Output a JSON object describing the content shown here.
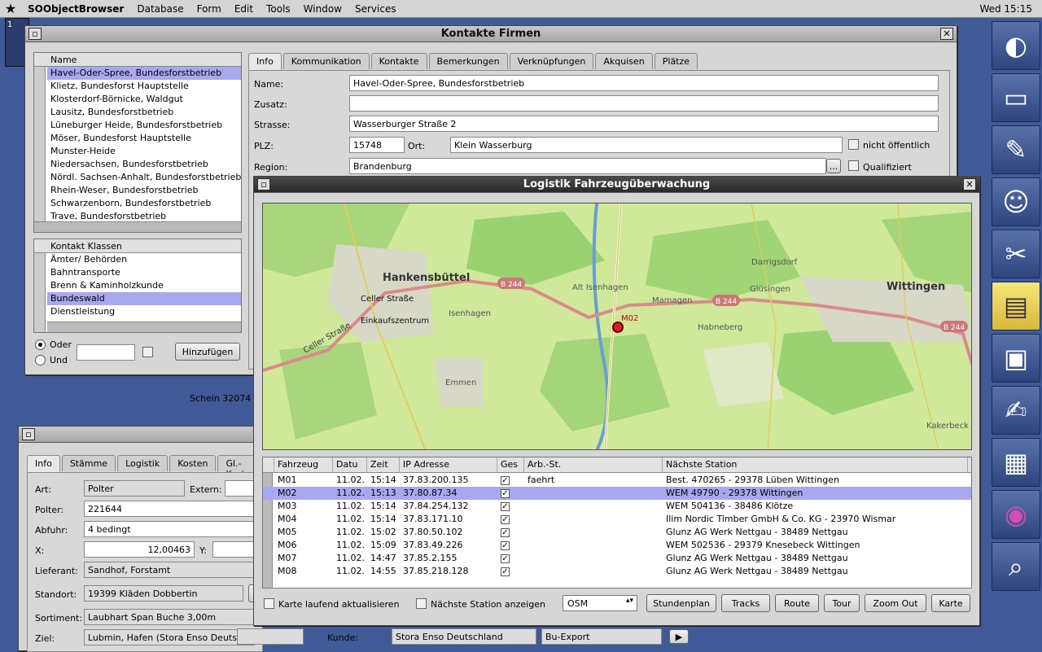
{
  "menubar": {
    "app": "SOObjectBrowser",
    "items": [
      "Database",
      "Form",
      "Edit",
      "Tools",
      "Window",
      "Services"
    ],
    "clock": "Wed 15:15"
  },
  "desktop": {
    "workspace_number": "1",
    "background_text": "Schein 32074"
  },
  "dock": [
    "system-icon",
    "monitor-icon",
    "paint-icon",
    "finder-icon",
    "tools-icon",
    "notes-icon",
    "terminal-icon",
    "textedit-icon",
    "graph-icon",
    "disk-icon",
    "magnifier-icon"
  ],
  "firmen": {
    "title": "Kontakte Firmen",
    "name_header": "Name",
    "names": [
      "Havel-Oder-Spree, Bundesforstbetrieb",
      "Klietz, Bundesforst Hauptstelle",
      "Klosterdorf-Börnicke, Waldgut",
      "Lausitz, Bundesforstbetrieb",
      "Lüneburger Heide, Bundesforstbetrieb",
      "Möser, Bundesforst Hauptstelle",
      "Munster-Heide",
      "Niedersachsen, Bundesforstbetrieb",
      "Nördl. Sachsen-Anhalt, Bundesforstbetrieb",
      "Rhein-Weser, Bundesforstbetrieb",
      "Schwarzenborn, Bundesforstbetrieb",
      "Trave, Bundesforstbetrieb"
    ],
    "klassen_header": "Kontakt Klassen",
    "klassen": [
      "Ämter/ Behörden",
      "Bahntransporte",
      "Brenn & Kaminholzkunde",
      "Bundeswald",
      "Dienstleistung"
    ],
    "oder": "Oder",
    "und": "Und",
    "add_button": "Hinzufügen",
    "tabs": [
      "Info",
      "Kommunikation",
      "Kontakte",
      "Bemerkungen",
      "Verknüpfungen",
      "Akquisen",
      "Plätze"
    ],
    "labels": {
      "name": "Name:",
      "zusatz": "Zusatz:",
      "strasse": "Strasse:",
      "plz": "PLZ:",
      "ort": "Ort:",
      "region": "Region:",
      "nicht_oeffentlich": "nicht öffentlich",
      "qualifiziert": "Qualifiziert"
    },
    "values": {
      "name": "Havel-Oder-Spree, Bundesforstbetrieb",
      "zusatz": "",
      "strasse": "Wasserburger Straße 2",
      "plz": "15748",
      "ort": "Klein Wasserburg",
      "region": "Brandenburg"
    },
    "region_button": "..."
  },
  "polter": {
    "tabs": [
      "Info",
      "Stämme",
      "Logistik",
      "Kosten",
      "Gl.-Kosten"
    ],
    "labels": {
      "art": "Art:",
      "extern": "Extern:",
      "polter": "Polter:",
      "abfuhr": "Abfuhr:",
      "x": "X:",
      "y": "Y:",
      "lieferant": "Lieferant:",
      "standort": "Standort:",
      "sortiment": "Sortiment:",
      "ziel": "Ziel:",
      "kunde": "Kunde:"
    },
    "values": {
      "art": "Polter",
      "polter": "221644",
      "abfuhr": "4 bedingt",
      "x": "12,00463",
      "lieferant": "Sandhof, Forstamt",
      "standort": "19399 Kläden Dobbertin",
      "sortiment": "Laubhart Span Buche 3,00m",
      "ziel": "Lubmin, Hafen (Stora Enso Deutschland GmbH)",
      "kunde": "Stora Enso Deutschland",
      "export": "Bu-Export"
    }
  },
  "logistik": {
    "title": "Logistik Fahrzeugüberwachung",
    "map_labels": [
      "Hankensbüttel",
      "Celler Straße",
      "Einkaufszentrum",
      "Isenhagen",
      "Alt Isenhagen",
      "Mamagen",
      "Habneberg",
      "Darrigsdorf",
      "Glüsingen",
      "Wittingen",
      "Emmen",
      "Kakerbeck",
      "Celler Straße",
      "B 244",
      "B 244",
      "B 244",
      "M02"
    ],
    "columns": [
      "Fahrzeug",
      "Datu",
      "Zeit",
      "IP Adresse",
      "Ges",
      "Arb.-St.",
      "Nächste Station"
    ],
    "rows": [
      {
        "fz": "M01",
        "datum": "11.02.",
        "zeit": "15:14",
        "ip": "37.83.200.135",
        "arb": "faehrt",
        "station": "Best. 470265 - 29378 Lüben Wittingen"
      },
      {
        "fz": "M02",
        "datum": "11.02.",
        "zeit": "15:13",
        "ip": "37.80.87.34",
        "arb": "",
        "station": "WEM 49790 - 29378 Wittingen"
      },
      {
        "fz": "M03",
        "datum": "11.02.",
        "zeit": "15:14",
        "ip": "37.84.254.132",
        "arb": "",
        "station": "WEM 504136 - 38486 Klötze"
      },
      {
        "fz": "M04",
        "datum": "11.02.",
        "zeit": "15:14",
        "ip": "37.83.171.10",
        "arb": "",
        "station": "Ilim Nordic Timber GmbH & Co. KG - 23970 Wismar"
      },
      {
        "fz": "M05",
        "datum": "11.02.",
        "zeit": "15:02",
        "ip": "37.80.50.102",
        "arb": "",
        "station": "Glunz AG Werk Nettgau - 38489 Nettgau"
      },
      {
        "fz": "M06",
        "datum": "11.02.",
        "zeit": "15:09",
        "ip": "37.83.49.226",
        "arb": "",
        "station": "WEM 502536 - 29379 Knesebeck Wittingen"
      },
      {
        "fz": "M07",
        "datum": "11.02.",
        "zeit": "14:47",
        "ip": "37.85.2.155",
        "arb": "",
        "station": "Glunz AG Werk Nettgau - 38489 Nettgau"
      },
      {
        "fz": "M08",
        "datum": "11.02.",
        "zeit": "14:55",
        "ip": "37.85.218.128",
        "arb": "",
        "station": "Glunz AG Werk Nettgau - 38489 Nettgau"
      }
    ],
    "chk_karte": "Karte laufend aktualisieren",
    "chk_station": "Nächste Station anzeigen",
    "map_source": "OSM",
    "buttons": [
      "Stundenplan",
      "Tracks",
      "Route",
      "Tour",
      "Zoom Out",
      "Karte"
    ]
  }
}
